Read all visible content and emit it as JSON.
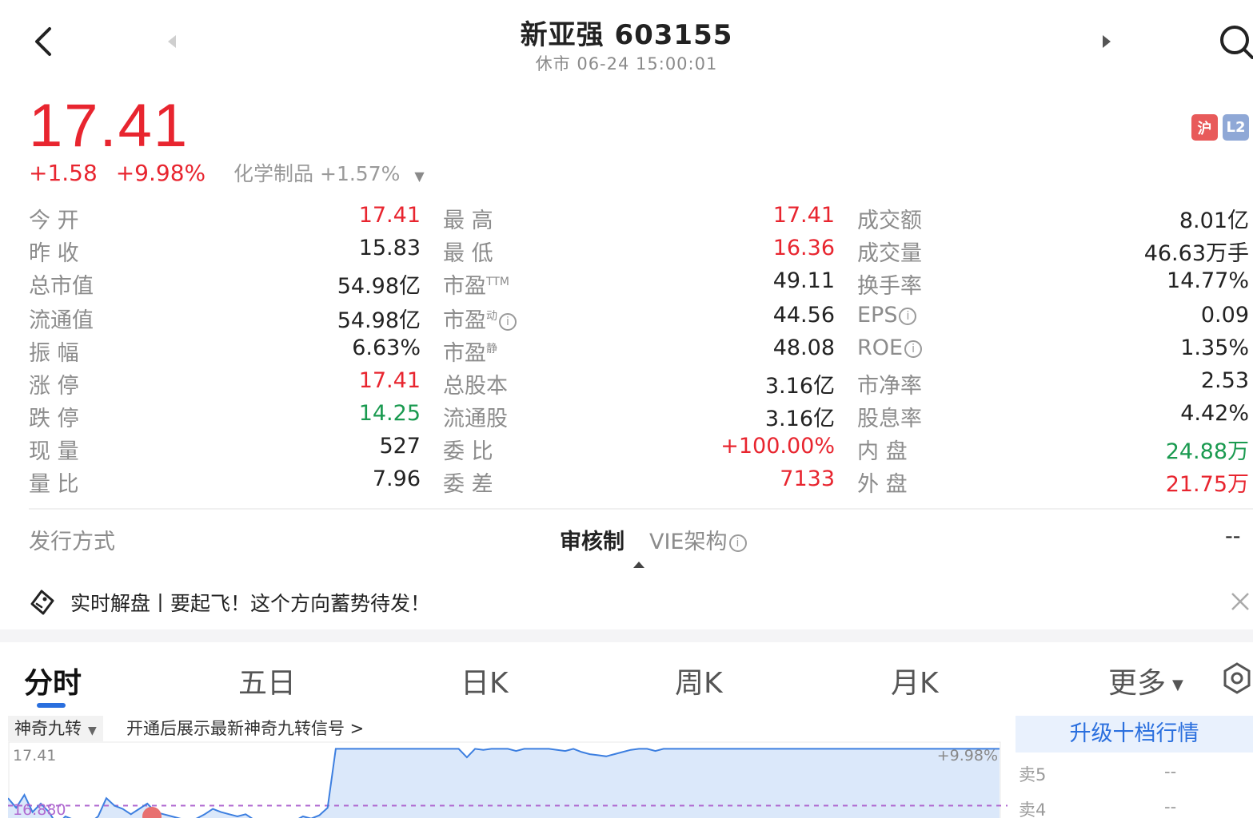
{
  "header": {
    "title": "新亚强 603155",
    "subtitle": "休市 06-24 15:00:01"
  },
  "quote": {
    "price": "17.41",
    "change": "+1.58",
    "change_pct": "+9.98%",
    "industry": "化学制品 +1.57%",
    "badges": [
      "沪",
      "L2"
    ],
    "price_color": "#e8252f"
  },
  "stats": [
    {
      "l1": "今  开",
      "v1": "17.41",
      "l2": "最  高",
      "v2": "17.41",
      "l3": "成交额",
      "v3": "8.01亿"
    },
    {
      "l1": "昨  收",
      "v1": "15.83",
      "l2": "最  低",
      "v2": "16.36",
      "l3": "成交量",
      "v3": "46.63万手"
    },
    {
      "l1": "总市值",
      "v1": "54.98亿",
      "l2": "市盈",
      "l2sup": "TTM",
      "v2": "49.11",
      "l3": "换手率",
      "v3": "14.77%"
    },
    {
      "l1": "流通值",
      "v1": "54.98亿",
      "l2": "市盈",
      "l2sup": "动",
      "v2": "44.56",
      "l3": "EPS",
      "v3": "0.09"
    },
    {
      "l1": "振  幅",
      "v1": "6.63%",
      "l2": "市盈",
      "l2sup": "静",
      "v2": "48.08",
      "l3": "ROE",
      "v3": "1.35%"
    },
    {
      "l1": "涨  停",
      "v1": "17.41",
      "l2": "总股本",
      "v2": "3.16亿",
      "l3": "市净率",
      "v3": "2.53"
    },
    {
      "l1": "跌  停",
      "v1": "14.25",
      "l2": "流通股",
      "v2": "3.16亿",
      "l3": "股息率",
      "v3": "4.42%"
    },
    {
      "l1": "现  量",
      "v1": "527",
      "l2": "委  比",
      "v2": "+100.00%",
      "l3": "内  盘",
      "v3": "24.88万"
    },
    {
      "l1": "量  比",
      "v1": "7.96",
      "l2": "委  差",
      "v2": "7133",
      "l3": "外  盘",
      "v3": "21.75万"
    }
  ],
  "issue": {
    "label": "发行方式",
    "value": "审核制",
    "vie_label": "VIE架构",
    "vie_value": "--"
  },
  "banner": {
    "text": "实时解盘丨要起飞！这个方向蓄势待发！"
  },
  "tabs": {
    "items": [
      "分时",
      "五日",
      "日K",
      "周K",
      "月K",
      "更多"
    ]
  },
  "chart_toolbar": {
    "indicator": "神奇九转",
    "promo": "开通后展示最新神奇九转信号 >"
  },
  "chart_data": {
    "type": "line",
    "title": "",
    "y_top_label": "17.41",
    "y_top_pct": "+9.98%",
    "y_low_label": "16.880",
    "ylim": [
      16.8,
      17.45
    ],
    "values": [
      16.95,
      16.86,
      16.98,
      16.82,
      16.9,
      16.82,
      16.7,
      16.78,
      16.75,
      16.74,
      16.72,
      16.78,
      16.95,
      16.88,
      16.85,
      16.8,
      16.85,
      16.9,
      16.82,
      16.8,
      16.78,
      16.76,
      16.74,
      16.76,
      16.8,
      16.85,
      16.82,
      16.8,
      16.78,
      16.8,
      16.75,
      16.72,
      16.74,
      16.7,
      16.72,
      16.74,
      16.78,
      16.76,
      16.79,
      16.86,
      17.41,
      17.41,
      17.41,
      17.41,
      17.41,
      17.41,
      17.41,
      17.41,
      17.41,
      17.41,
      17.41,
      17.41,
      17.41,
      17.41,
      17.41,
      17.41,
      17.33,
      17.41,
      17.4,
      17.41,
      17.41,
      17.41,
      17.39,
      17.41,
      17.41,
      17.41,
      17.41,
      17.4,
      17.39,
      17.41,
      17.38,
      17.36,
      17.35,
      17.34,
      17.36,
      17.38,
      17.4,
      17.41,
      17.41,
      17.39,
      17.41,
      17.41,
      17.41,
      17.41,
      17.41,
      17.41,
      17.41,
      17.41,
      17.41,
      17.41,
      17.41,
      17.41,
      17.41,
      17.41,
      17.41,
      17.41,
      17.41,
      17.41,
      17.41,
      17.41,
      17.41,
      17.41,
      17.41,
      17.41,
      17.41,
      17.41,
      17.41,
      17.41,
      17.41,
      17.41,
      17.41,
      17.41,
      17.41,
      17.41,
      17.41,
      17.41,
      17.41,
      17.41,
      17.41,
      17.41,
      17.41,
      17.41
    ],
    "dashed_ref": 16.88,
    "line_color": "#3d7fe0"
  },
  "depth": {
    "upgrade": "升级十档行情",
    "asks": [
      {
        "label": "卖5",
        "value": "--"
      },
      {
        "label": "卖4",
        "value": "--"
      }
    ]
  }
}
